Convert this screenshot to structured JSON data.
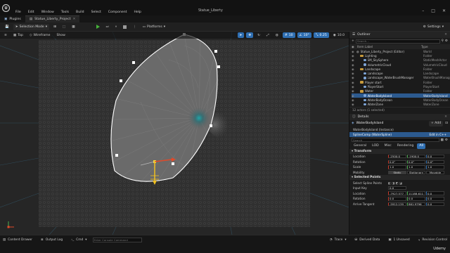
{
  "menu": [
    "File",
    "Edit",
    "Window",
    "Tools",
    "Build",
    "Select",
    "Component",
    "Help"
  ],
  "window_title": "Statue_Liberty",
  "tabs": [
    {
      "label": "Plugins"
    },
    {
      "label": "Statue_Liberty_Project"
    }
  ],
  "toolbar": {
    "selection_mode": "Selection Mode",
    "platforms": "Platforms",
    "settings": "Settings"
  },
  "viewport": {
    "view_mode": "Top",
    "render_mode": "Wireframe",
    "show": "Show",
    "grid_snap": "10",
    "rot_snap": "10°",
    "scale_snap": "0.25",
    "cam_speed": "10.0"
  },
  "outliner": {
    "title": "Outliner",
    "search_placeholder": "Search...",
    "col_item": "Item Label",
    "col_type": "Type",
    "items": [
      {
        "name": "Statue_Liberty_Project (Editor)",
        "type": "World",
        "kind": "world",
        "indent": 0
      },
      {
        "name": "Lighting",
        "type": "Folder",
        "kind": "folder",
        "indent": 1
      },
      {
        "name": "SM_SkySphere",
        "type": "StaticMeshActor",
        "kind": "actor",
        "indent": 2
      },
      {
        "name": "VolumetricCloud",
        "type": "VolumetricCloud",
        "kind": "actor",
        "indent": 2
      },
      {
        "name": "Landscape",
        "type": "Folder",
        "kind": "folder",
        "indent": 1
      },
      {
        "name": "Landscape",
        "type": "Landscape",
        "kind": "actor",
        "indent": 2
      },
      {
        "name": "Landscape_WaterBrushManager",
        "type": "WaterBrushManager",
        "kind": "actor",
        "indent": 2
      },
      {
        "name": "Player start",
        "type": "Folder",
        "kind": "folder",
        "indent": 1
      },
      {
        "name": "PlayerStart",
        "type": "PlayerStart",
        "kind": "actor",
        "indent": 2
      },
      {
        "name": "Water",
        "type": "Folder",
        "kind": "folder",
        "indent": 1
      },
      {
        "name": "WaterBodyIsland",
        "type": "WaterBodyIsland",
        "kind": "actor",
        "indent": 2,
        "selected": true
      },
      {
        "name": "WaterBodyOcean",
        "type": "WaterBodyOcean",
        "kind": "actor",
        "indent": 2
      },
      {
        "name": "WaterZone",
        "type": "WaterZone",
        "kind": "actor",
        "indent": 2
      }
    ],
    "footer": "12 actors (1 selected)"
  },
  "details": {
    "title": "Details",
    "actor_name": "WaterBodyIsland",
    "add_label": "+ Add",
    "instance_label": "WaterBodyIsland (Instance)",
    "component_label": "SplineComp (WaterSpline)",
    "edit_cpp": "Edit in C++",
    "search_placeholder": "Search",
    "filter_tabs": [
      "General",
      "LOD",
      "Misc",
      "Rendering",
      "All"
    ],
    "active_filter": "All",
    "transform_header": "Transform",
    "location_label": "Location",
    "location": [
      "-2500.0",
      "-1900.0",
      "0.0"
    ],
    "rotation_label": "Rotation",
    "rotation": [
      "0.0°",
      "0.0°",
      "0.0°"
    ],
    "scale_label": "Scale",
    "scale": [
      "1.0",
      "1.0",
      "1.0"
    ],
    "mobility_label": "Mobility",
    "mobility_options": [
      "Static",
      "Stationary",
      "Movable"
    ],
    "mobility_selected": "Static",
    "selected_points_header": "Selected Points",
    "select_spline_points": "Select Spline Points",
    "input_key_label": "Input Key",
    "input_key": "0.0",
    "sp_location_label": "Location",
    "sp_location": [
      "-7927.577",
      "11188.611",
      "0.0"
    ],
    "sp_rotation_label": "Rotation",
    "sp_rotation": [
      "0.0",
      "0.0",
      "0.0"
    ],
    "arrive_tangent_label": "Arrive Tangent",
    "arrive_tangent": [
      "-5912.139",
      "861.9796",
      "0.0"
    ]
  },
  "statusbar": {
    "content_drawer": "Content Drawer",
    "output_log": "Output Log",
    "cmd": "Cmd",
    "console_placeholder": "Enter Console Command",
    "trace": "Trace",
    "derived_data": "Derived Data",
    "unsaved": "1 Unsaved",
    "revision_control": "Revision Control",
    "watermark": "Udemy"
  },
  "colors": {
    "accent": "#2f6fb2",
    "selection": "#2c5a8f",
    "play": "#46b33a",
    "spline_outline": "#ffffff",
    "water_center": "#1fa5a8"
  }
}
